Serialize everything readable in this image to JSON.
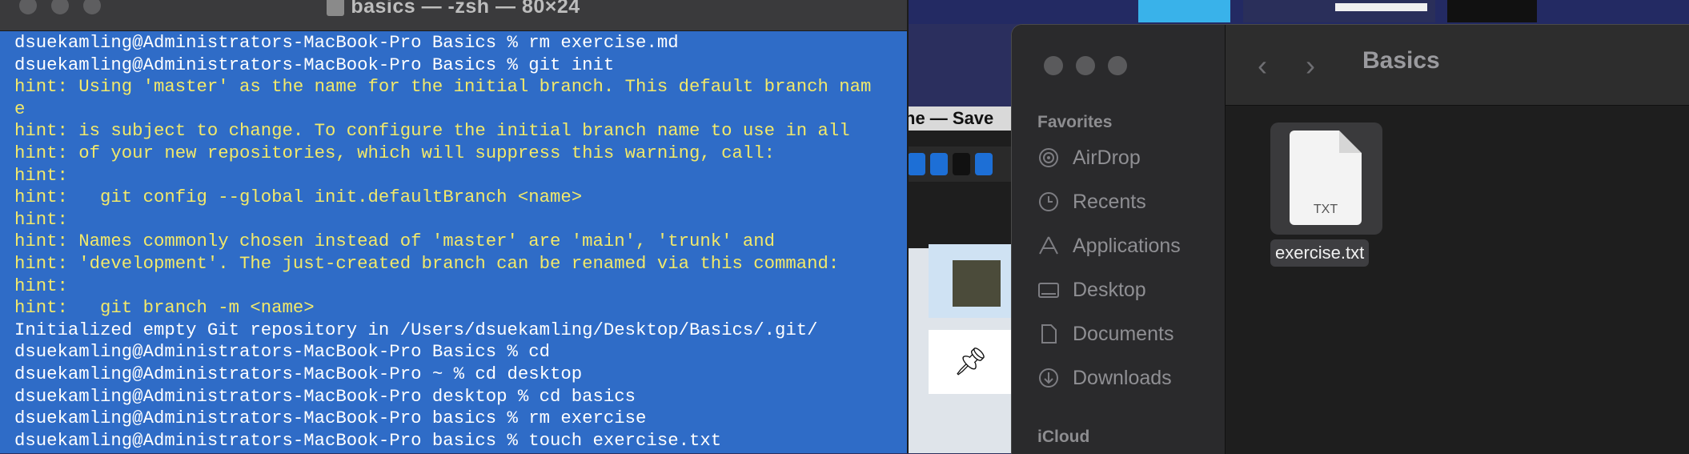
{
  "terminal": {
    "title": "basics — -zsh — 80×24",
    "lines": [
      {
        "text": "dsuekamling@Administrators-MacBook-Pro Basics % rm exercise.md",
        "kind": "cmd"
      },
      {
        "text": "dsuekamling@Administrators-MacBook-Pro Basics % git init",
        "kind": "cmd"
      },
      {
        "text": "hint: Using 'master' as the name for the initial branch. This default branch nam",
        "kind": "hint"
      },
      {
        "text": "e",
        "kind": "hint"
      },
      {
        "text": "hint: is subject to change. To configure the initial branch name to use in all",
        "kind": "hint"
      },
      {
        "text": "hint: of your new repositories, which will suppress this warning, call:",
        "kind": "hint"
      },
      {
        "text": "hint:",
        "kind": "hint"
      },
      {
        "text": "hint:   git config --global init.defaultBranch <name>",
        "kind": "hint"
      },
      {
        "text": "hint:",
        "kind": "hint"
      },
      {
        "text": "hint: Names commonly chosen instead of 'master' are 'main', 'trunk' and",
        "kind": "hint"
      },
      {
        "text": "hint: 'development'. The just-created branch can be renamed via this command:",
        "kind": "hint"
      },
      {
        "text": "hint:",
        "kind": "hint"
      },
      {
        "text": "hint:   git branch -m <name>",
        "kind": "hint"
      },
      {
        "text": "Initialized empty Git repository in /Users/dsuekamling/Desktop/Basics/.git/",
        "kind": "out"
      },
      {
        "text": "dsuekamling@Administrators-MacBook-Pro Basics % cd",
        "kind": "cmd"
      },
      {
        "text": "dsuekamling@Administrators-MacBook-Pro ~ % cd desktop",
        "kind": "cmd"
      },
      {
        "text": "dsuekamling@Administrators-MacBook-Pro desktop % cd basics",
        "kind": "cmd"
      },
      {
        "text": "dsuekamling@Administrators-MacBook-Pro basics % rm exercise",
        "kind": "cmd"
      },
      {
        "text": "dsuekamling@Administrators-MacBook-Pro basics % touch exercise.txt",
        "kind": "cmd"
      }
    ]
  },
  "background_window": {
    "title_fragment": "ne — Save"
  },
  "finder": {
    "path_title": "Basics",
    "sidebar": {
      "favorites_header": "Favorites",
      "icloud_header": "iCloud",
      "items": [
        {
          "label": "AirDrop",
          "icon": "airdrop-icon"
        },
        {
          "label": "Recents",
          "icon": "clock-icon"
        },
        {
          "label": "Applications",
          "icon": "applications-icon"
        },
        {
          "label": "Desktop",
          "icon": "desktop-icon"
        },
        {
          "label": "Documents",
          "icon": "document-icon"
        },
        {
          "label": "Downloads",
          "icon": "download-icon"
        }
      ]
    },
    "file": {
      "name": "exercise.txt",
      "ext": "TXT"
    }
  },
  "colors": {
    "terminal_bg": "#2f6cc7",
    "hint_text": "#f2e96a",
    "finder_bg": "#1e1e1e"
  }
}
